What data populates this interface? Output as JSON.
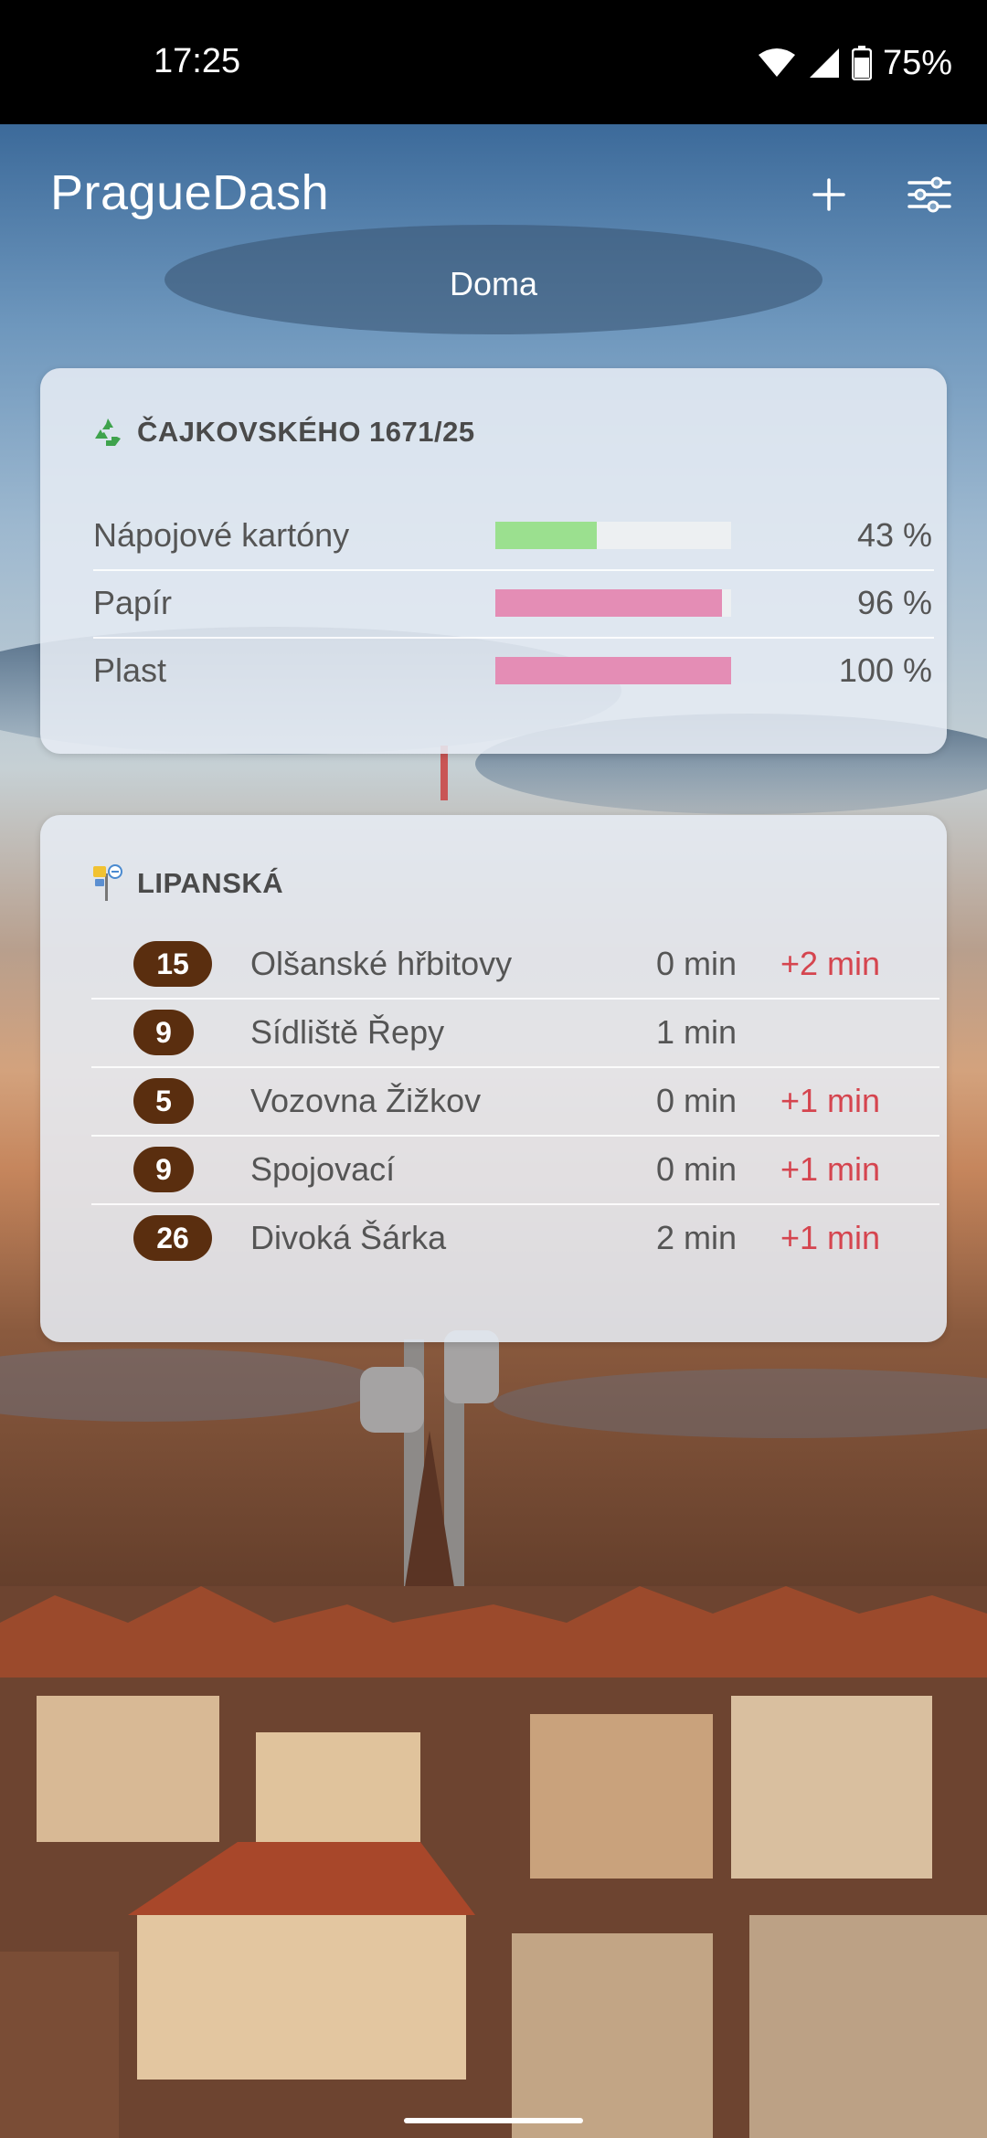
{
  "status": {
    "time": "17:25",
    "battery": "75%"
  },
  "app": {
    "title": "PragueDash",
    "subtitle": "Doma"
  },
  "waste": {
    "title": "ČAJKOVSKÉHO 1671/25",
    "icon": "recycle-icon",
    "rows": [
      {
        "label": "Nápojové kartóny",
        "percent": "43 %",
        "fill": 0.43,
        "color": "#9be08f"
      },
      {
        "label": "Papír",
        "percent": "96 %",
        "fill": 0.96,
        "color": "#e48db5"
      },
      {
        "label": "Plast",
        "percent": "100 %",
        "fill": 1.0,
        "color": "#e48db5"
      }
    ]
  },
  "transit": {
    "title": "LIPANSKÁ",
    "icon": "tram-stop-icon",
    "departures": [
      {
        "line": "15",
        "destination": "Olšanské hřbitovy",
        "time": "0 min",
        "delay": "+2 min"
      },
      {
        "line": "9",
        "destination": "Sídliště Řepy",
        "time": "1 min",
        "delay": ""
      },
      {
        "line": "5",
        "destination": "Vozovna Žižkov",
        "time": "0 min",
        "delay": "+1 min"
      },
      {
        "line": "9",
        "destination": "Spojovací",
        "time": "0 min",
        "delay": "+1 min"
      },
      {
        "line": "26",
        "destination": "Divoká Šárka",
        "time": "2 min",
        "delay": "+1 min"
      }
    ]
  }
}
